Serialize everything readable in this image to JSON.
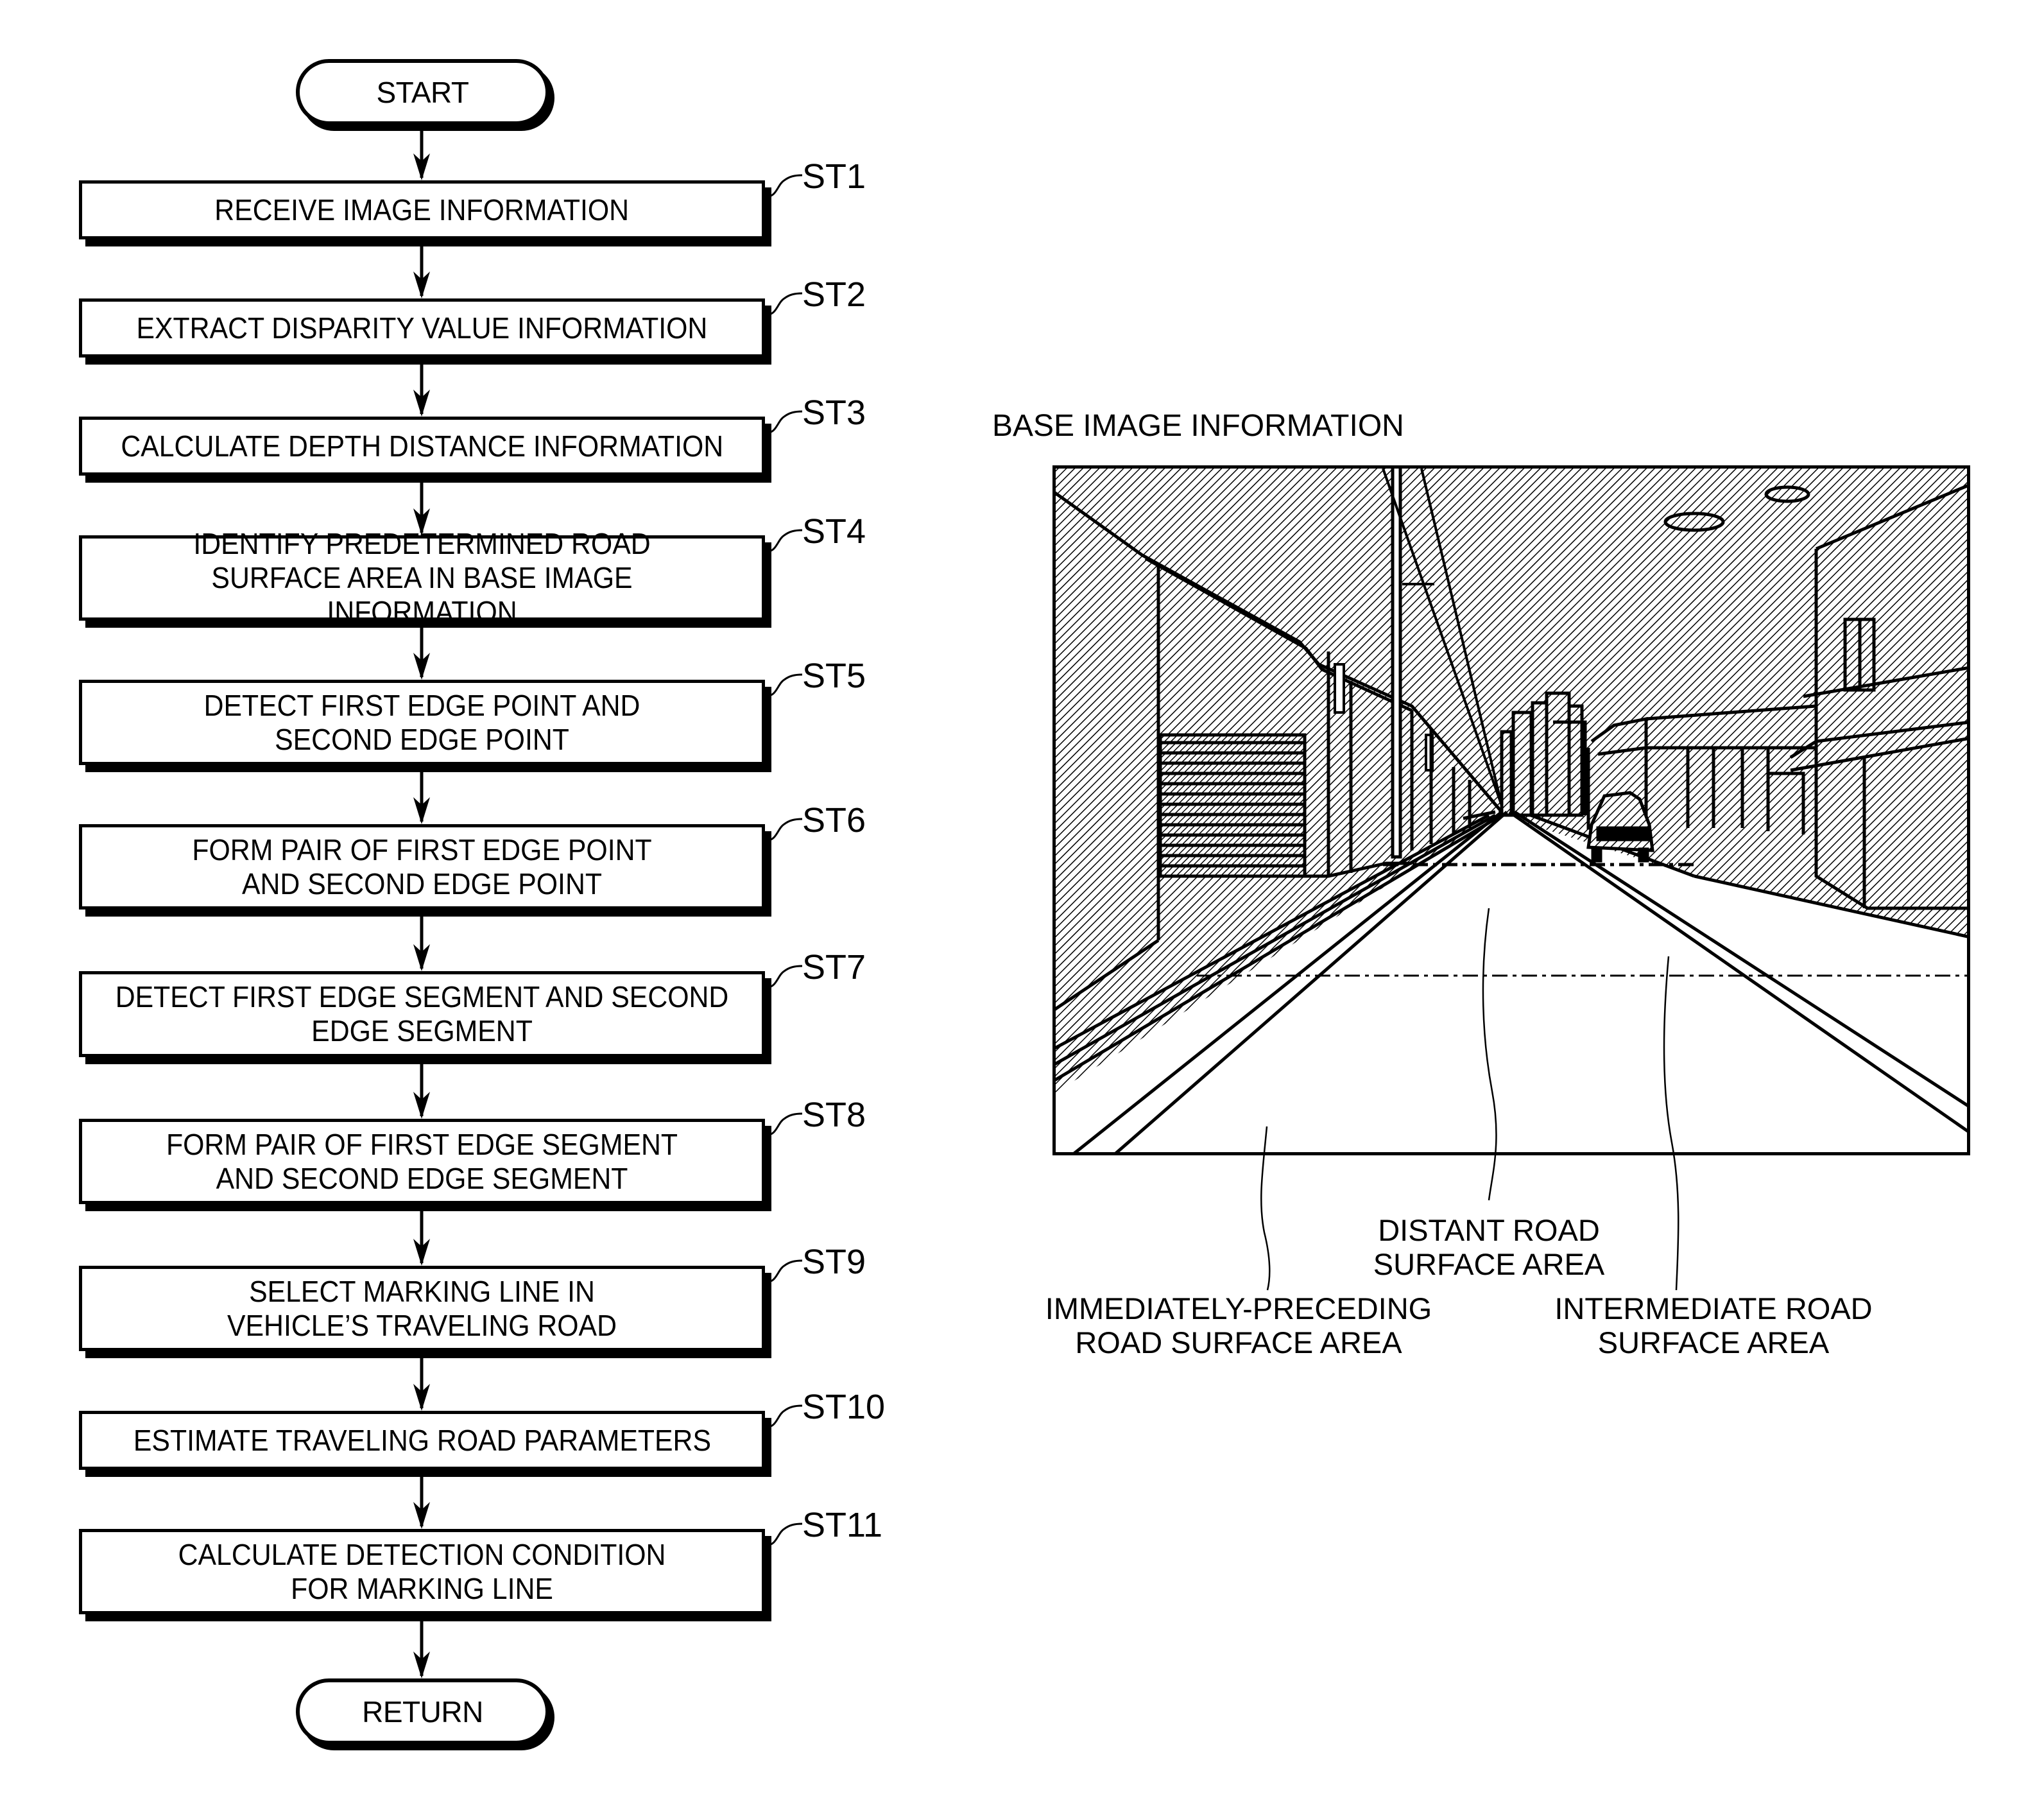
{
  "flowchart": {
    "start_label": "START",
    "return_label": "RETURN",
    "steps": [
      {
        "id": "ST1",
        "text": "RECEIVE IMAGE INFORMATION"
      },
      {
        "id": "ST2",
        "text": "EXTRACT DISPARITY VALUE INFORMATION"
      },
      {
        "id": "ST3",
        "text": "CALCULATE DEPTH DISTANCE INFORMATION"
      },
      {
        "id": "ST4",
        "text": "IDENTIFY PREDETERMINED ROAD SURFACE AREA IN BASE IMAGE INFORMATION"
      },
      {
        "id": "ST5",
        "text": "DETECT FIRST EDGE POINT AND SECOND EDGE POINT"
      },
      {
        "id": "ST6",
        "text": "FORM PAIR OF FIRST EDGE POINT AND SECOND EDGE POINT"
      },
      {
        "id": "ST7",
        "text": "DETECT FIRST EDGE SEGMENT AND SECOND EDGE SEGMENT"
      },
      {
        "id": "ST8",
        "text": "FORM PAIR OF FIRST EDGE SEGMENT AND SECOND EDGE SEGMENT"
      },
      {
        "id": "ST9",
        "text": "SELECT MARKING LINE IN VEHICLE’S TRAVELING ROAD"
      },
      {
        "id": "ST10",
        "text": "ESTIMATE TRAVELING ROAD PARAMETERS"
      },
      {
        "id": "ST11",
        "text": "CALCULATE DETECTION CONDITION FOR MARKING LINE"
      }
    ]
  },
  "illustration": {
    "title": "BASE IMAGE INFORMATION",
    "labels": {
      "distant": "DISTANT ROAD SURFACE AREA",
      "immediately_preceding": "IMMEDIATELY-PRECEDING ROAD SURFACE AREA",
      "intermediate": "INTERMEDIATE ROAD SURFACE AREA"
    }
  }
}
